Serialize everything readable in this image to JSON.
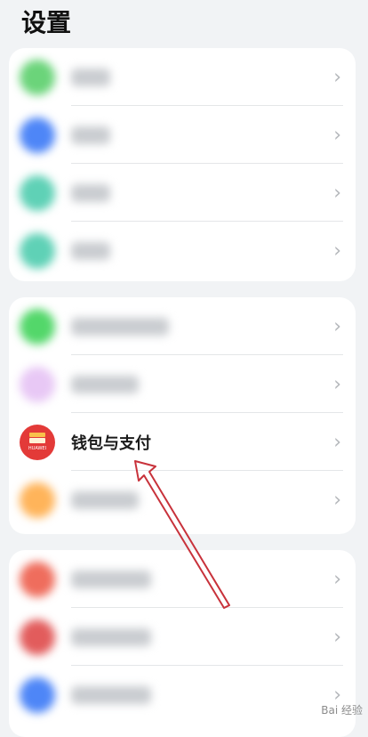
{
  "header": {
    "title": "设置"
  },
  "accent": "#e33a38",
  "wallet_row": {
    "label": "钱包与支付",
    "icon": "huawei-wallet-icon",
    "brand": "HUAWEI"
  },
  "chevron_glyph": "›",
  "watermark": "Bai 经验"
}
